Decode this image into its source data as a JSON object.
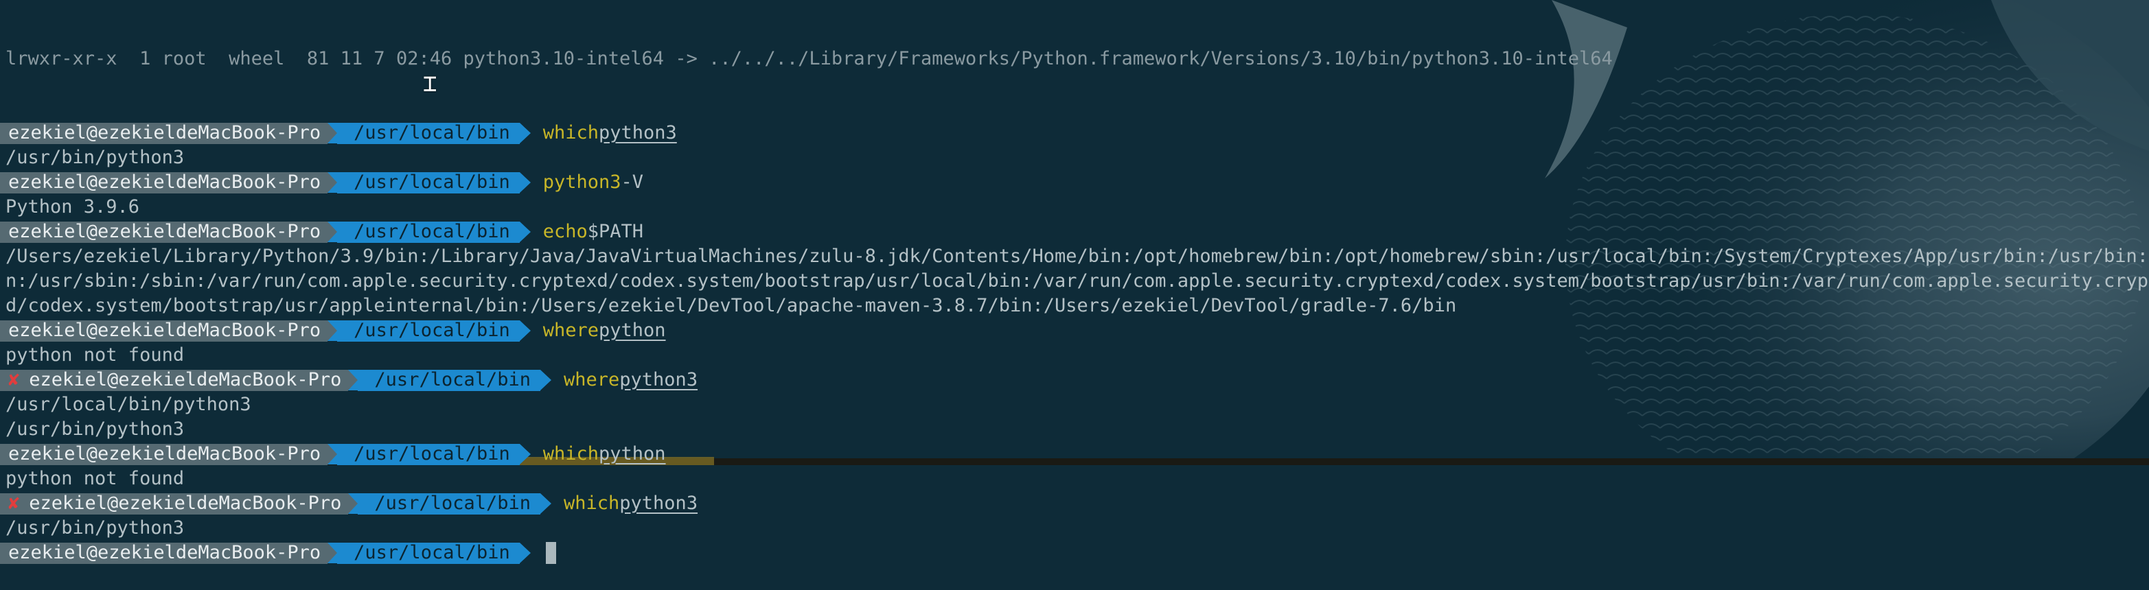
{
  "terminal": {
    "top_partial": "lrwxr-xr-x  1 root  wheel  81 11 7 02:46 python3.10-intel64 -> ../../../Library/Frameworks/Python.framework/Versions/3.10/bin/python3.10-intel64",
    "prompt": {
      "user": "ezekiel@ezekieldeMacBook-Pro",
      "path": "/usr/local/bin",
      "error_mark": "✘"
    },
    "lines": [
      {
        "cmd": "which",
        "arg": "python3"
      },
      {
        "output": "/usr/bin/python3"
      },
      {
        "cmd": "python3",
        "arg": "-V"
      },
      {
        "output": "Python 3.9.6"
      },
      {
        "cmd": "echo",
        "arg": "$PATH"
      },
      {
        "output": "/Users/ezekiel/Library/Python/3.9/bin:/Library/Java/JavaVirtualMachines/zulu-8.jdk/Contents/Home/bin:/opt/homebrew/bin:/opt/homebrew/sbin:/usr/local/bin:/System/Cryptexes/App/usr/bin:/usr/bin:/bi"
      },
      {
        "output": "n:/usr/sbin:/sbin:/var/run/com.apple.security.cryptexd/codex.system/bootstrap/usr/local/bin:/var/run/com.apple.security.cryptexd/codex.system/bootstrap/usr/bin:/var/run/com.apple.security.cryptex"
      },
      {
        "output": "d/codex.system/bootstrap/usr/appleinternal/bin:/Users/ezekiel/DevTool/apache-maven-3.8.7/bin:/Users/ezekiel/DevTool/gradle-7.6/bin"
      },
      {
        "cmd": "where",
        "arg": "python"
      },
      {
        "output": "python not found"
      },
      {
        "cmd": "where",
        "arg": "python3",
        "error": true
      },
      {
        "output": "/usr/local/bin/python3"
      },
      {
        "output": "/usr/bin/python3"
      },
      {
        "cmd": "which",
        "arg": "python"
      },
      {
        "output": "python not found"
      },
      {
        "cmd": "which",
        "arg": "python3",
        "error": true
      },
      {
        "output": "/usr/bin/python3"
      },
      {
        "cmd": "",
        "arg": "",
        "cursor": true
      }
    ]
  },
  "colors": {
    "background": "#0e2b38",
    "user_segment": "#566a72",
    "path_segment": "#1c8ad0",
    "command": "#c8b628",
    "error_mark": "#e23d3d"
  }
}
